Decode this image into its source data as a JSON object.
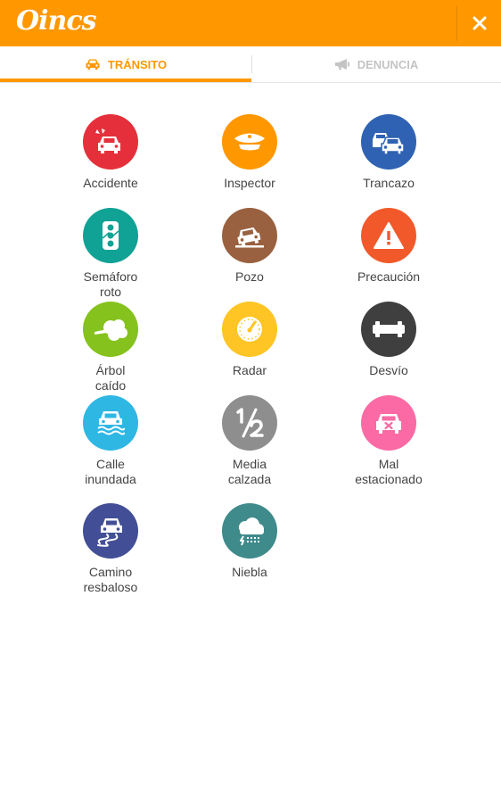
{
  "app": {
    "logo_text": "Oincs",
    "close_label": "✕"
  },
  "tabs": [
    {
      "label": "TRÁNSITO",
      "active": true,
      "icon": "car-icon"
    },
    {
      "label": "DENUNCIA",
      "active": false,
      "icon": "megaphone-icon"
    }
  ],
  "colors": {
    "brand": "#ff9800",
    "inactive_tab": "#c4c4c4"
  },
  "items": [
    {
      "label": "Accidente",
      "color": "#e5303b",
      "icon": "car-crash-icon"
    },
    {
      "label": "Inspector",
      "color": "#ff9800",
      "icon": "police-cap-icon"
    },
    {
      "label": "Trancazo",
      "color": "#2f62b2",
      "icon": "traffic-jam-icon"
    },
    {
      "label": "Semáforo\nroto",
      "color": "#10a295",
      "icon": "traffic-light-icon"
    },
    {
      "label": "Pozo",
      "color": "#99613f",
      "icon": "pothole-icon"
    },
    {
      "label": "Precaución",
      "color": "#f2592a",
      "icon": "warning-icon"
    },
    {
      "label": "Árbol\ncaído",
      "color": "#86c21d",
      "icon": "fallen-tree-icon"
    },
    {
      "label": "Radar",
      "color": "#fec525",
      "icon": "speedometer-icon"
    },
    {
      "label": "Desvío",
      "color": "#3f3f3f",
      "icon": "detour-barrier-icon"
    },
    {
      "label": "Calle\ninundada",
      "color": "#2fb7e4",
      "icon": "flooded-street-icon"
    },
    {
      "label": "Media\ncalzada",
      "color": "#8e8e8e",
      "icon": "half-road-icon"
    },
    {
      "label": "Mal\nestacionado",
      "color": "#fb6aa4",
      "icon": "bad-parking-icon"
    },
    {
      "label": "Camino\nresbaloso",
      "color": "#424f96",
      "icon": "slippery-road-icon"
    },
    {
      "label": "Niebla",
      "color": "#3f8a8b",
      "icon": "fog-icon"
    }
  ]
}
